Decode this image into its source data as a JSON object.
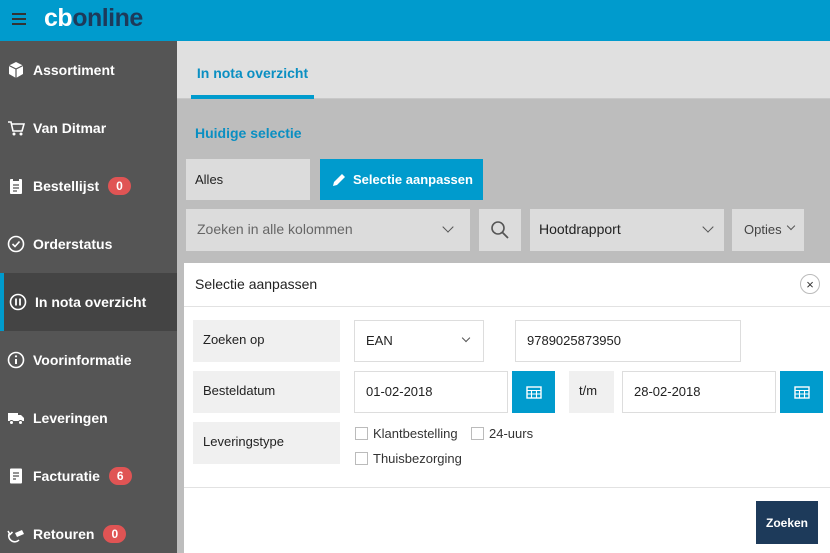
{
  "app": {
    "logo_cb": "cb",
    "logo_online": "online"
  },
  "sidebar": {
    "items": [
      {
        "label": "Assortiment",
        "icon": "box-icon"
      },
      {
        "label": "Van Ditmar",
        "icon": "cart-icon"
      },
      {
        "label": "Bestellijst",
        "icon": "clipboard-icon",
        "badge": "0"
      },
      {
        "label": "Orderstatus",
        "icon": "check-circle-icon"
      },
      {
        "label": "In nota overzicht",
        "icon": "pause-circle-icon",
        "active": true
      },
      {
        "label": "Voorinformatie",
        "icon": "info-circle-icon"
      },
      {
        "label": "Leveringen",
        "icon": "truck-icon"
      },
      {
        "label": "Facturatie",
        "icon": "invoice-icon",
        "badge": "6"
      },
      {
        "label": "Retouren",
        "icon": "return-box-icon",
        "badge": "0"
      }
    ]
  },
  "main": {
    "tab": "In nota overzicht",
    "section_title": "Huidige selectie",
    "selection_value": "Alles",
    "selection_button": "Selectie aanpassen",
    "search_placeholder": "Zoeken in alle kolommen",
    "report_select": "Hootdrapport",
    "options_label": "Opties"
  },
  "modal": {
    "title": "Selectie aanpassen",
    "close": "×",
    "search_on_label": "Zoeken op",
    "search_on_value": "EAN",
    "search_value": "9789025873950",
    "order_date_label": "Besteldatum",
    "date_from": "01-02-2018",
    "date_sep": "t/m",
    "date_to": "28-02-2018",
    "delivery_type_label": "Leveringstype",
    "checkboxes": [
      "Klantbestelling",
      "24-uurs",
      "Thuisbezorging"
    ],
    "submit": "Zoeken"
  },
  "colors": {
    "accent": "#009bcd",
    "sidebar": "#555555",
    "dark_blue": "#1d3a5a",
    "badge": "#e05454"
  }
}
